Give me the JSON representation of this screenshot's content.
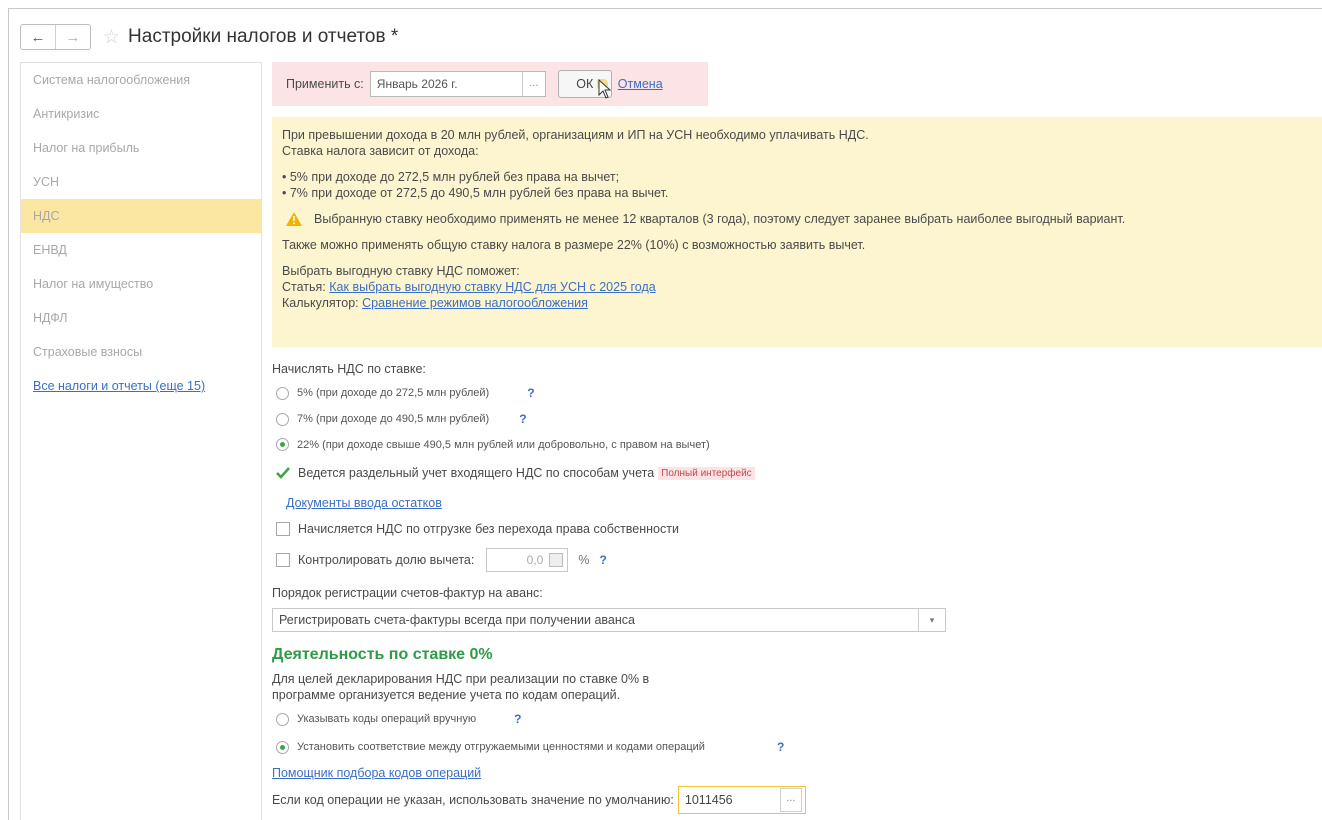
{
  "window": {
    "title": "Настройки налогов и отчетов *"
  },
  "nav": {
    "back": "←",
    "forward": "→",
    "star": "☆"
  },
  "sidebar": {
    "items": [
      {
        "label": "Система налогообложения"
      },
      {
        "label": "Антикризис"
      },
      {
        "label": "Налог на прибыль"
      },
      {
        "label": "УСН"
      },
      {
        "label": "НДС",
        "active": true
      },
      {
        "label": "ЕНВД"
      },
      {
        "label": "Налог на имущество"
      },
      {
        "label": "НДФЛ"
      },
      {
        "label": "Страховые взносы"
      },
      {
        "label": "Все налоги и отчеты (еще 15)",
        "link": true
      }
    ]
  },
  "apply": {
    "label": "Применить с:",
    "date_value": "Январь 2026 г.",
    "date_button": "...",
    "ok_label": "ОК",
    "cancel_label": "Отмена"
  },
  "info": {
    "line1": "При превышении дохода в 20 млн рублей, организациям и ИП на УСН необходимо уплачивать НДС.",
    "line2": "Ставка налога зависит от дохода:",
    "bullet1": "• 5% при доходе до 272,5 млн рублей без права на вычет;",
    "bullet2": "• 7% при доходе от 272,5 до 490,5 млн рублей без права на вычет.",
    "warning": "Выбранную ставку необходимо применять не менее 12 кварталов (3 года), поэтому следует заранее выбрать наиболее выгодный вариант.",
    "general_rate": "Также можно применять общую ставку налога в размере 22% (10%) с возможностью заявить вычет.",
    "help_intro": "Выбрать выгодную ставку НДС поможет:",
    "article_label": "Статья:",
    "article_link": "Как выбрать выгодную ставку НДС для УСН с 2025 года",
    "calculator_label": "Калькулятор:",
    "calculator_link": "Сравнение режимов налогообложения"
  },
  "form": {
    "rate_heading": "Начислять НДС по ставке:",
    "rate_options": [
      {
        "label": "5% (при доходе до 272,5 млн рублей)",
        "selected": false
      },
      {
        "label": "7% (при доходе до 490,5 млн рублей)",
        "selected": false
      },
      {
        "label": "22% (при доходе свыше 490,5 млн рублей или добровольно, с правом на вычет)",
        "selected": true
      }
    ],
    "help_mark": "?",
    "separate_accounting": {
      "label": "Ведется раздельный учет входящего НДС по способам учета",
      "checked": true,
      "badge": "Полный интерфейс"
    },
    "opening_balances_link": "Документы ввода остатков",
    "shipment_vat": {
      "label": "Начисляется НДС по отгрузке без перехода права собственности",
      "checked": false
    },
    "deduction_share": {
      "label": "Контролировать долю вычета:",
      "checked": false,
      "value": "0,0",
      "unit": "%"
    },
    "invoice_order_label": "Порядок регистрации счетов-фактур на аванс:",
    "invoice_order_value": "Регистрировать счета-фактуры всегда при получении аванса",
    "zero_rate_title": "Деятельность по ставке 0%",
    "zero_rate_desc1": "Для целей декларирования НДС при реализации по ставке 0% в",
    "zero_rate_desc2": "программе организуется ведение учета по кодам операций.",
    "op_code_options": [
      {
        "label": "Указывать коды операций вручную",
        "selected": false
      },
      {
        "label": "Установить соответствие между отгружаемыми ценностями и кодами операций",
        "selected": true
      }
    ],
    "op_code_helper_link": "Помощник подбора кодов операций",
    "default_code_label": "Если код операции не указан, использовать значение по умолчанию:",
    "default_code_value": "1011456",
    "default_code_button": "..."
  },
  "colors": {
    "active_item": "#fbe6a2",
    "info_bg": "#fcf5d0",
    "apply_bg": "#fbe3e6",
    "link": "#3c6fc4",
    "check": "#3aa54a",
    "section_title": "#2f9a48"
  }
}
